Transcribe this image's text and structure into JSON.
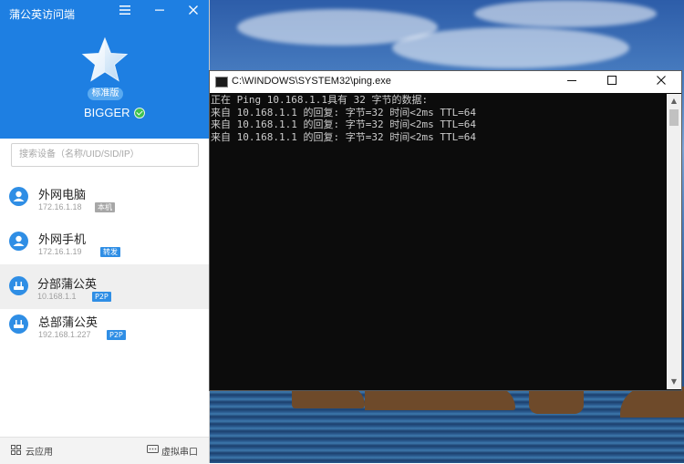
{
  "app": {
    "title": "蒲公英访问端",
    "edition": "标准版",
    "username": "BIGGER",
    "search_placeholder": "搜索设备（名称/UID/SID/IP）",
    "devices": [
      {
        "name": "外网电脑",
        "ip": "172.16.1.18",
        "tag": "本机",
        "tag_color": "gray",
        "icon": "user-icon"
      },
      {
        "name": "外网手机",
        "ip": "172.16.1.19",
        "tag": "转发",
        "tag_color": "blue",
        "icon": "user-icon"
      },
      {
        "name": "分部蒲公英",
        "ip": "10.168.1.1",
        "tag": "P2P",
        "tag_color": "blue",
        "icon": "router-icon",
        "selected": true
      },
      {
        "name": "总部蒲公英",
        "ip": "192.168.1.227",
        "tag": "P2P",
        "tag_color": "blue",
        "icon": "router-icon"
      }
    ],
    "footer": {
      "cloud_apps": "云应用",
      "virtual_serial": "虚拟串口"
    }
  },
  "cmd": {
    "title": "C:\\WINDOWS\\SYSTEM32\\ping.exe",
    "lines": [
      "正在 Ping 10.168.1.1具有 32 字节的数据:",
      "来自 10.168.1.1 的回复: 字节=32 时间<2ms TTL=64",
      "来自 10.168.1.1 的回复: 字节=32 时间<2ms TTL=64",
      "来自 10.168.1.1 的回复: 字节=32 时间<2ms TTL=64"
    ]
  },
  "colors": {
    "brand_blue": "#1e7fe2",
    "online_green": "#3ec24f"
  }
}
